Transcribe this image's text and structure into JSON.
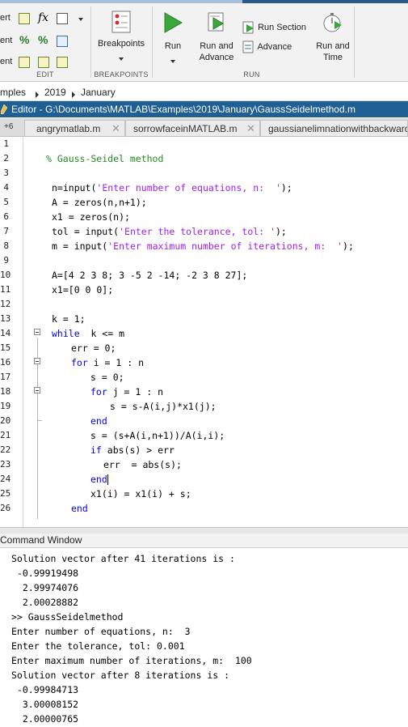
{
  "toolstrip": {
    "edit_rows": [
      "ert",
      "ent",
      "ent"
    ],
    "breakpoints_label": "Breakpoints",
    "run_label": "Run",
    "run_advance_line1": "Run and",
    "run_advance_line2": "Advance",
    "run_section_label": "Run Section",
    "advance_label": "Advance",
    "run_time_line1": "Run and",
    "run_time_line2": "Time",
    "group_edit": "EDIT",
    "group_breakpoints": "BREAKPOINTS",
    "group_run": "RUN"
  },
  "path": [
    "mples",
    "2019",
    "January"
  ],
  "editor": {
    "title": "Editor - G:\\Documents\\MATLAB\\Examples\\2019\\January\\GaussSeidelmethod.m",
    "tab_overflow": "+6",
    "tabs": [
      "angrymatlab.m",
      "sorrowfaceinMATLAB.m",
      "gaussianelimnationwithbackward"
    ]
  },
  "code": {
    "line_numbers": [
      "1",
      "2",
      "3",
      "4",
      "5",
      "6",
      "7",
      "8",
      "9",
      "10",
      "11",
      "12",
      "13",
      "14",
      "15",
      "16",
      "17",
      "18",
      "19",
      "20",
      "21",
      "22",
      "23",
      "24",
      "25",
      "26"
    ],
    "l2": "% Gauss-Seidel method",
    "l4a": "n=input(",
    "l4s": "'Enter number of equations, n:  '",
    "l4b": ");",
    "l5": "A = zeros(n,n+1);",
    "l6": "x1 = zeros(n);",
    "l7a": "tol = input(",
    "l7s": "'Enter the tolerance, tol: '",
    "l7b": ");",
    "l8a": "m = input(",
    "l8s": "'Enter maximum number of iterations, m:  '",
    "l8b": ");",
    "l10": "A=[4 2 3 8; 3 -5 2 -14; -2 3 8 27];",
    "l11": "x1=[0 0 0];",
    "l13": "k = 1;",
    "l14k": "while",
    "l14b": "  k <= m",
    "l15": "err = 0;",
    "l16k": "for",
    "l16b": " i = 1 : n",
    "l17": "s = 0;",
    "l18k": "for",
    "l18b": " j = 1 : n",
    "l19": "s = s-A(i,j)*x1(j);",
    "l20k": "end",
    "l21": "s = (s+A(i,n+1))/A(i,i);",
    "l22k": "if",
    "l22b": " abs(s) > err",
    "l23": "err  = abs(s);",
    "l24k": "end",
    "l25": "x1(i) = x1(i) + s;",
    "l26k": "end"
  },
  "command_window": {
    "title": "Command Window",
    "lines": [
      "Solution vector after 41 iterations is :",
      " -0.99919498",
      "  2.99974076",
      "  2.00028882",
      ">> GaussSeidelmethod",
      "Enter number of equations, n:  3",
      "Enter the tolerance, tol: 0.001",
      "Enter maximum number of iterations, m:  100",
      "Solution vector after 8 iterations is :",
      " -0.99984713",
      "  3.00008152",
      "  2.00000765"
    ]
  }
}
